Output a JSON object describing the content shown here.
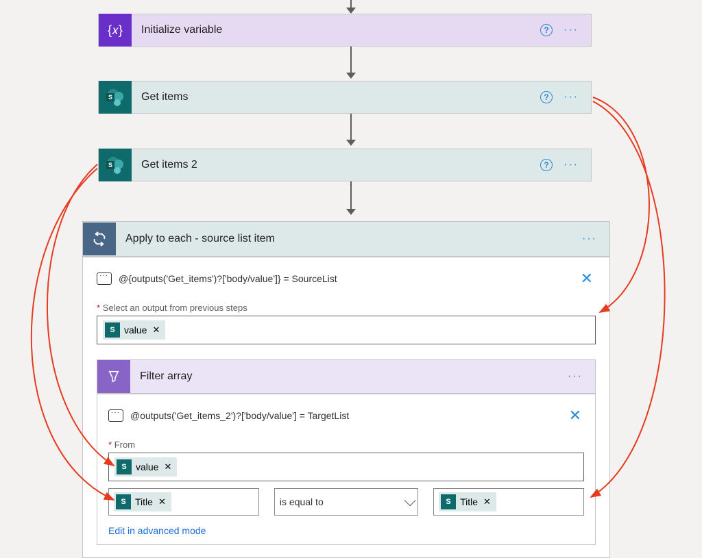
{
  "steps": {
    "init_var": {
      "title": "Initialize variable"
    },
    "get_items": {
      "title": "Get items"
    },
    "get_items_2": {
      "title": "Get items 2"
    }
  },
  "apply_each": {
    "title": "Apply to each - source list item",
    "comment": "@{outputs('Get_items')?['body/value']} = SourceList",
    "select_label": "Select an output from previous steps",
    "value_token": "value"
  },
  "filter": {
    "title": "Filter array",
    "comment": "@outputs('Get_items_2')?['body/value'] = TargetList",
    "from_label": "From",
    "from_token": "value",
    "left_token": "Title",
    "operator": "is equal to",
    "right_token": "Title",
    "advanced_link": "Edit in advanced mode"
  }
}
